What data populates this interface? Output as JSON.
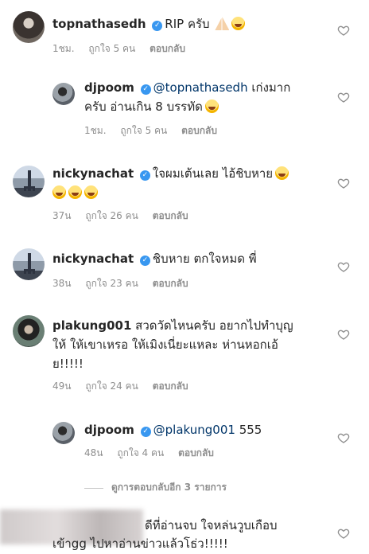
{
  "comments": [
    {
      "username": "topnathasedh",
      "text": "RIP ครับ",
      "time": "1ชม.",
      "likes": "ถูกใจ 5 คน",
      "reply": "ตอบกลับ"
    },
    {
      "username": "djpoom",
      "mention": "@topnathasedh",
      "text_line1": "เก่งมาก",
      "text_line2": "ครับ อ่านเกิน 8 บรรทัด",
      "time": "1ชม.",
      "likes": "ถูกใจ 5 คน",
      "reply": "ตอบกลับ"
    },
    {
      "username": "nickynachat",
      "text": "ใจผมเต้นเลย ไอ้ชิบหาย",
      "time": "37น",
      "likes": "ถูกใจ 26 คน",
      "reply": "ตอบกลับ"
    },
    {
      "username": "nickynachat",
      "text": "ชิบหาย ตกใจหมด พี่",
      "time": "38น",
      "likes": "ถูกใจ 23 คน",
      "reply": "ตอบกลับ"
    },
    {
      "username": "plakung001",
      "text_line1": "สวดวัดไหนครับ อยากไปทำบุญ",
      "text_line2": "ให้ ให้เขาเหรอ ให้เมิงเนี่ยะแหละ ห่านหอกเอ้",
      "text_line3": "ย!!!!!",
      "time": "49น",
      "likes": "ถูกใจ 24 คน",
      "reply": "ตอบกลับ"
    },
    {
      "username": "djpoom",
      "mention": "@plakung001",
      "text": "555",
      "time": "48น",
      "likes": "ถูกใจ 4 คน",
      "reply": "ตอบกลับ"
    },
    {
      "text_line1": "ดีที่อ่านจบ ใจหล่นวูบเกือบ",
      "text_line2": "เข้าgg ไปหาอ่านข่าวแล้วโธ่ว!!!!!"
    }
  ],
  "view_more": "ดูการตอบกลับอีก 3 รายการ",
  "verified_glyph": "✓",
  "colors": {
    "username": "#262626",
    "meta": "#8e8e8e",
    "mention": "#003569",
    "verified": "#3897f0"
  },
  "icons": [
    "heart-outline-icon",
    "verified-badge-icon",
    "emoji-icon",
    "praying-hands-icon"
  ]
}
